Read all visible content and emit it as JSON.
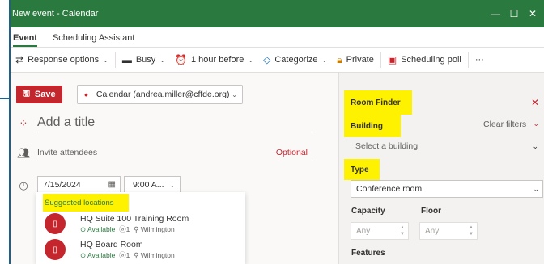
{
  "window": {
    "title": "New event - Calendar",
    "minimize": "—",
    "maximize": "☐",
    "close": "✕"
  },
  "tabs": [
    {
      "label": "Event",
      "active": true
    },
    {
      "label": "Scheduling Assistant",
      "active": false
    }
  ],
  "toolbar": {
    "response_options": "Response options",
    "busy": "Busy",
    "reminder": "1 hour before",
    "categorize": "Categorize",
    "private": "Private",
    "scheduling_poll": "Scheduling poll",
    "more": "···"
  },
  "event": {
    "save_label": "Save",
    "calendar": "Calendar (andrea.miller@cffde.org)",
    "title_placeholder": "Add a title",
    "attendees_placeholder": "Invite attendees",
    "optional_label": "Optional",
    "date": "7/15/2024",
    "time": "9:00 A..."
  },
  "suggestions": {
    "header": "Suggested locations",
    "rooms": [
      {
        "name": "HQ Suite 100 Training Room",
        "status": "Available",
        "capacity": "1",
        "location": "Wilmington"
      },
      {
        "name": "HQ Board Room",
        "status": "Available",
        "capacity": "1",
        "location": "Wilmington"
      }
    ]
  },
  "room_finder": {
    "title": "Room Finder",
    "building_label": "Building",
    "clear_filters": "Clear filters",
    "building_placeholder": "Select a building",
    "type_label": "Type",
    "type_value": "Conference room",
    "capacity_label": "Capacity",
    "floor_label": "Floor",
    "capacity_value": "Any",
    "floor_value": "Any",
    "features_label": "Features"
  },
  "colors": {
    "titlebar": "#2a7a3f",
    "accent_red": "#c4262e",
    "highlight": "#fff200"
  }
}
